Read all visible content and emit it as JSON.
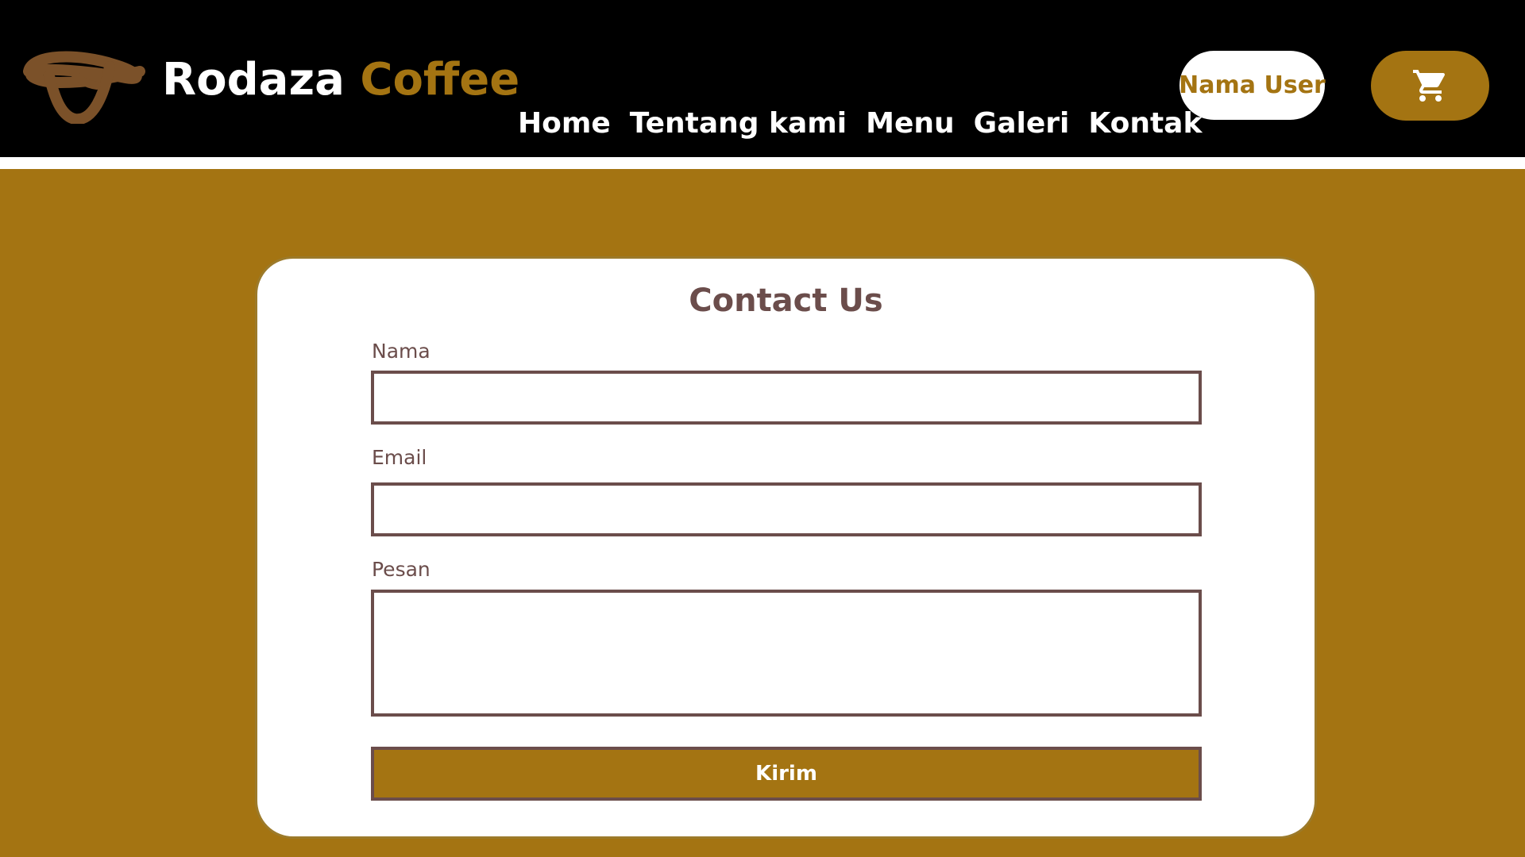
{
  "header": {
    "brand_name": "Rodaza",
    "brand_accent": "Coffee",
    "logo_icon": "coffee-scribble-logo",
    "nav": [
      "Home",
      "Tentang kami",
      "Menu",
      "Galeri",
      "Kontak"
    ],
    "user_button": "Nama User",
    "cart_icon": "shopping-cart-icon"
  },
  "form": {
    "title": "Contact Us",
    "name_label": "Nama",
    "name_value": "",
    "email_label": "Email",
    "email_value": "",
    "message_label": "Pesan",
    "message_value": "",
    "submit_label": "Kirim"
  },
  "colors": {
    "primary": "#A47412",
    "header_bg": "#000000",
    "text_brown": "#6B4D4B",
    "logo_brown": "#7B5129"
  }
}
